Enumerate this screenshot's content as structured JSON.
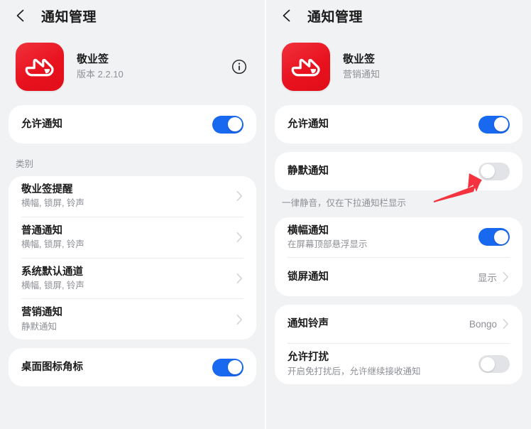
{
  "colors": {
    "page_bg": "#f1f2f4",
    "card_bg": "#ffffff",
    "accent_on": "#1868f0",
    "toggle_off": "#e2e3e6",
    "app_icon_red": "#e8121f",
    "annotation_red": "#f5333f",
    "primary_text": "#1b1b1b",
    "secondary_text": "#8d8f95"
  },
  "left": {
    "header": {
      "back_icon": "arrow-left-icon",
      "title": "通知管理"
    },
    "app": {
      "icon_name": "jingyeqian-app-icon",
      "name": "敬业签",
      "sub": "版本 2.2.10",
      "info_icon": "info-circle-icon"
    },
    "allow": {
      "title": "允许通知",
      "toggle_state": "on"
    },
    "category_label": "类别",
    "categories": [
      {
        "title": "敬业签提醒",
        "sub": "横幅, 锁屏, 铃声",
        "chevron": "chevron-right-icon"
      },
      {
        "title": "普通通知",
        "sub": "横幅, 锁屏, 铃声",
        "chevron": "chevron-right-icon"
      },
      {
        "title": "系统默认通道",
        "sub": "横幅, 锁屏, 铃声",
        "chevron": "chevron-right-icon"
      },
      {
        "title": "营销通知",
        "sub": "静默通知",
        "chevron": "chevron-right-icon"
      }
    ],
    "badge": {
      "title": "桌面图标角标",
      "toggle_state": "on"
    }
  },
  "right": {
    "header": {
      "back_icon": "arrow-left-icon",
      "title": "通知管理"
    },
    "app": {
      "icon_name": "jingyeqian-app-icon",
      "name": "敬业签",
      "sub": "营销通知"
    },
    "allow": {
      "title": "允许通知",
      "toggle_state": "on"
    },
    "silent": {
      "title": "静默通知",
      "toggle_state": "off",
      "note": "一律静音，仅在下拉通知栏显示"
    },
    "banner": {
      "title": "横幅通知",
      "sub": "在屏幕顶部悬浮显示",
      "toggle_state": "on"
    },
    "lockscreen": {
      "title": "锁屏通知",
      "value": "显示",
      "chevron": "chevron-right-icon"
    },
    "ringtone": {
      "title": "通知铃声",
      "value": "Bongo",
      "chevron": "chevron-right-icon"
    },
    "interrupt": {
      "title": "允许打扰",
      "sub": "开启免打扰后，允许继续接收通知",
      "toggle_state": "off"
    },
    "annotation": {
      "name": "red-arrow-annotation",
      "points_to": "静默通知 toggle"
    }
  }
}
